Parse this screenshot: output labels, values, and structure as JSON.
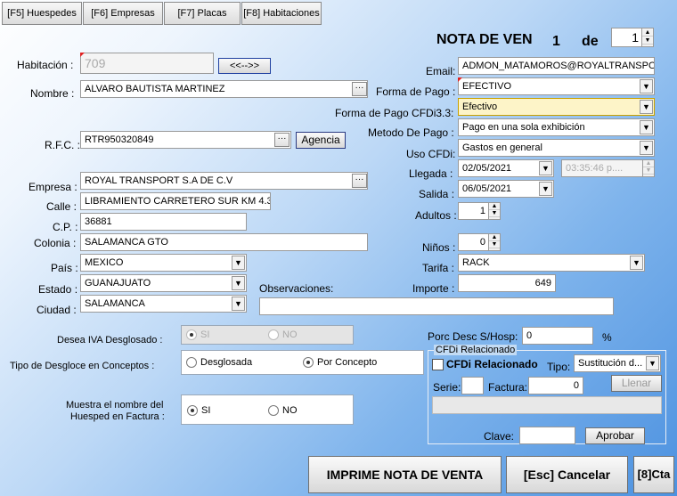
{
  "tabs": [
    "[F5] Huespedes",
    "[F6] Empresas",
    "[F7] Placas",
    "[F8] Habitaciones"
  ],
  "header": {
    "title": "NOTA DE VEN",
    "num": "1",
    "of": "de",
    "total": "1"
  },
  "left": {
    "habitacion_label": "Habitación :",
    "habitacion_value": "709",
    "swap_button": "<<-->>",
    "nombre_label": "Nombre :",
    "nombre_value": "ALVARO BAUTISTA MARTINEZ",
    "rfc_label": "R.F.C. :",
    "rfc_value": "RTR950320849",
    "agencia_button": "Agencia",
    "empresa_label": "Empresa :",
    "empresa_value": "ROYAL TRANSPORT S.A DE C.V",
    "calle_label": "Calle :",
    "calle_value": "LIBRAMIENTO CARRETERO SUR KM 4.3",
    "cp_label": "C.P. :",
    "cp_value": "36881",
    "colonia_label": "Colonia :",
    "colonia_value": "SALAMANCA GTO",
    "pais_label": "País :",
    "pais_value": "MEXICO",
    "estado_label": "Estado :",
    "estado_value": "GUANAJUATO",
    "ciudad_label": "Ciudad :",
    "ciudad_value": "SALAMANCA",
    "observaciones_label": "Observaciones:"
  },
  "right": {
    "email_label": "Email:",
    "email_value": "ADMON_MATAMOROS@ROYALTRANSPORTS",
    "forma_pago_label": "Forma de Pago :",
    "forma_pago_value": "EFECTIVO",
    "forma_pago_cfdi_label": "Forma de Pago CFDi3.3:",
    "forma_pago_cfdi_value": "Efectivo",
    "metodo_label": "Metodo De Pago :",
    "metodo_value": "Pago en una sola exhibición",
    "uso_label": "Uso CFDi:",
    "uso_value": "Gastos en general",
    "llegada_label": "Llegada :",
    "llegada_value": "02/05/2021",
    "llegada_time": "03:35:46 p....",
    "salida_label": "Salida :",
    "salida_value": "06/05/2021",
    "adultos_label": "Adultos :",
    "adultos_value": "1",
    "ninos_label": "Niños :",
    "ninos_value": "0",
    "tarifa_label": "Tarifa :",
    "tarifa_value": "RACK",
    "importe_label": "Importe :",
    "importe_value": "649"
  },
  "options": {
    "iva_label": "Desea IVA Desglosado :",
    "iva_si": "SI",
    "iva_no": "NO",
    "desgloce_label": "Tipo de Desgloce  en Conceptos :",
    "desglosada": "Desglosada",
    "por_concepto": "Por Concepto",
    "muestra_label_1": "Muestra el nombre del",
    "muestra_label_2": "Huesped en Factura :",
    "muestra_si": "SI",
    "muestra_no": "NO"
  },
  "desc": {
    "label": "Porc Desc S/Hosp:",
    "value": "0",
    "unit": "%"
  },
  "cfdi": {
    "group_title": "CFDi Relacionado",
    "check_label": "CFDi Relacionado",
    "tipo_label": "Tipo:",
    "tipo_value": "Sustitución d...",
    "serie_label": "Serie:",
    "serie_value": "",
    "factura_label": "Factura:",
    "factura_value": "0",
    "llenar_button": "Llenar",
    "clave_label": "Clave:",
    "clave_value": "",
    "aprobar_button": "Aprobar"
  },
  "footer": {
    "imprime": "IMPRIME NOTA DE VENTA",
    "cancelar": "[Esc] Cancelar",
    "cta": "[8]Cta"
  }
}
